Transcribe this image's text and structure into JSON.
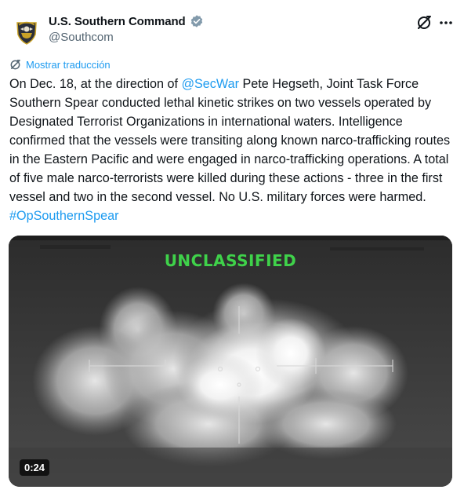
{
  "author": {
    "display_name": "U.S. Southern Command",
    "handle": "@Southcom",
    "verified_icon": "verified-badge-icon",
    "avatar_icon": "southcom-emblem"
  },
  "translate": {
    "label": "Mostrar traducción",
    "icon": "translate-icon"
  },
  "tweet": {
    "text_1": "On Dec. 18, at the direction of ",
    "mention": "@SecWar",
    "text_2": " Pete Hegseth, Joint Task Force Southern Spear conducted lethal kinetic strikes on two vessels operated by Designated Terrorist Organizations in international waters. Intelligence confirmed that the vessels were transiting along known narco-trafficking routes in the Eastern Pacific and were engaged in narco-trafficking operations. A total of five male narco-terrorists were killed during these actions - three in the first vessel and two in the second vessel. No U.S. military forces were harmed. ",
    "hashtag": "#OpSouthernSpear"
  },
  "media": {
    "classification_label": "UNCLASSIFIED",
    "duration": "0:24"
  },
  "colors": {
    "link": "#1d9bf0",
    "secondary_text": "#536471",
    "classification_green": "#3fd24a"
  }
}
